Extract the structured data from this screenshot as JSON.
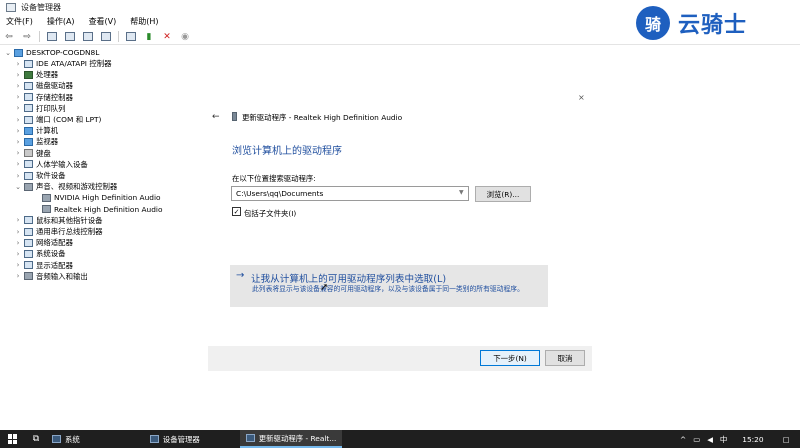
{
  "window": {
    "title": "设备管理器"
  },
  "menu": [
    "文件(F)",
    "操作(A)",
    "查看(V)",
    "帮助(H)"
  ],
  "tree": {
    "root": "DESKTOP-COGDN8L",
    "items": [
      {
        "label": "IDE ATA/ATAPI 控制器",
        "chev": "›",
        "icon": "disk-controller-icon"
      },
      {
        "label": "处理器",
        "chev": "›",
        "icon": "processor-icon"
      },
      {
        "label": "磁盘驱动器",
        "chev": "›",
        "icon": "disk-drive-icon"
      },
      {
        "label": "存储控制器",
        "chev": "›",
        "icon": "storage-controller-icon"
      },
      {
        "label": "打印队列",
        "chev": "›",
        "icon": "printer-icon"
      },
      {
        "label": "端口 (COM 和 LPT)",
        "chev": "›",
        "icon": "port-icon"
      },
      {
        "label": "计算机",
        "chev": "›",
        "icon": "computer-icon"
      },
      {
        "label": "监视器",
        "chev": "›",
        "icon": "monitor-icon"
      },
      {
        "label": "键盘",
        "chev": "›",
        "icon": "keyboard-icon"
      },
      {
        "label": "人体学输入设备",
        "chev": "›",
        "icon": "hid-icon"
      },
      {
        "label": "软件设备",
        "chev": "›",
        "icon": "software-device-icon"
      },
      {
        "label": "声音、视频和游戏控制器",
        "chev": "⌄",
        "icon": "sound-icon"
      },
      {
        "label": "NVIDIA High Definition Audio",
        "chev": "",
        "icon": "speaker-icon",
        "child": true
      },
      {
        "label": "Realtek High Definition Audio",
        "chev": "",
        "icon": "speaker-icon",
        "child": true
      },
      {
        "label": "鼠标和其他指针设备",
        "chev": "›",
        "icon": "mouse-icon"
      },
      {
        "label": "通用串行总线控制器",
        "chev": "›",
        "icon": "usb-icon"
      },
      {
        "label": "网络适配器",
        "chev": "›",
        "icon": "network-icon"
      },
      {
        "label": "系统设备",
        "chev": "›",
        "icon": "system-device-icon"
      },
      {
        "label": "显示适配器",
        "chev": "›",
        "icon": "display-adapter-icon"
      },
      {
        "label": "音频输入和输出",
        "chev": "›",
        "icon": "audio-io-icon"
      }
    ]
  },
  "dialog": {
    "close": "×",
    "back": "←",
    "title": "更新驱动程序 - Realtek High Definition Audio",
    "heading": "浏览计算机上的驱动程序",
    "search_label": "在以下位置搜索驱动程序:",
    "path_value": "C:\\Users\\qq\\Documents",
    "browse": "浏览(R)...",
    "include_subfolders": "包括子文件夹(I)",
    "include_checked": "✓",
    "pick_arrow": "→",
    "pick_title": "让我从计算机上的可用驱动程序列表中选取(L)",
    "pick_desc": "此列表将显示与该设备兼容的可用驱动程序，以及与该设备属于同一类别的所有驱动程序。",
    "next": "下一步(N)",
    "cancel": "取消"
  },
  "watermark": {
    "badge": "骑",
    "text": "云骑士"
  },
  "taskbar": {
    "items": [
      "系统",
      "设备管理器",
      "更新驱动程序 - Realt..."
    ],
    "tray": {
      "chevron": "^",
      "ime": "中",
      "time": "15:20"
    }
  }
}
